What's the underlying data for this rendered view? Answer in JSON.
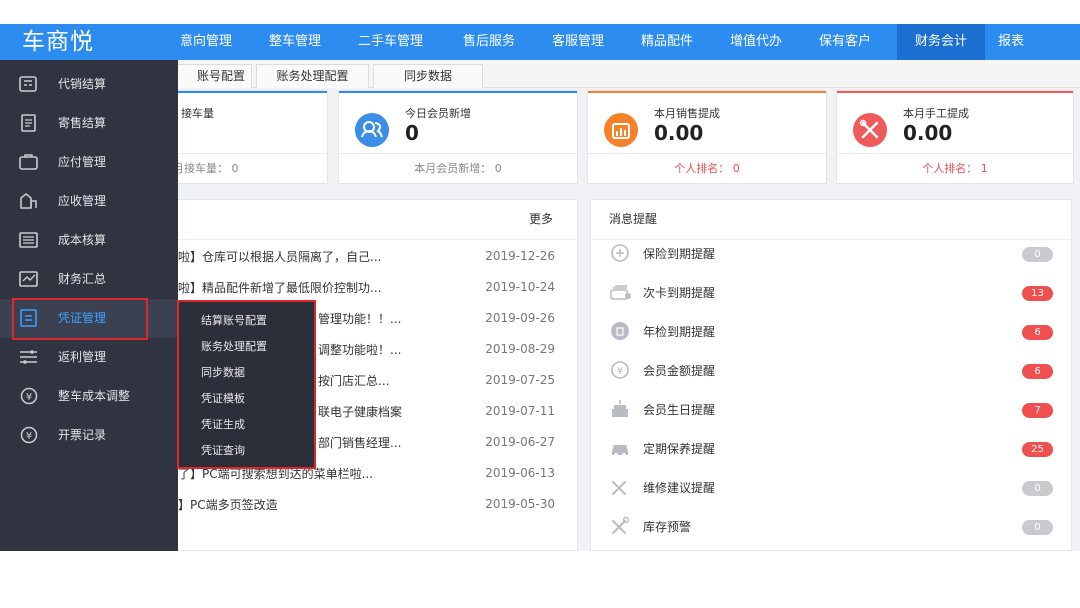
{
  "header": {
    "logo": "车商悦",
    "nav": [
      "意向管理",
      "整车管理",
      "二手车管理",
      "售后服务",
      "客服管理",
      "精品配件",
      "增值代办",
      "保有客户",
      "财务会计",
      "报表"
    ],
    "active_nav": "财务会计"
  },
  "tabs": [
    "账号配置",
    "账务处理配置",
    "同步数据"
  ],
  "sidebar": {
    "items": [
      {
        "label": "代销结算",
        "icon": "calculator-icon"
      },
      {
        "label": "寄售结算",
        "icon": "document-icon"
      },
      {
        "label": "应付管理",
        "icon": "wallet-icon"
      },
      {
        "label": "应收管理",
        "icon": "chart-icon"
      },
      {
        "label": "成本核算",
        "icon": "ledger-icon"
      },
      {
        "label": "财务汇总",
        "icon": "summary-icon"
      },
      {
        "label": "凭证管理",
        "icon": "voucher-icon"
      },
      {
        "label": "返利管理",
        "icon": "list-icon"
      },
      {
        "label": "整车成本调整",
        "icon": "yen-circle-icon"
      },
      {
        "label": "开票记录",
        "icon": "yen-circle-icon"
      }
    ],
    "active_item": "凭证管理"
  },
  "submenu": {
    "items": [
      "结算账号配置",
      "账务处理配置",
      "同步数据",
      "凭证模板",
      "凭证生成",
      "凭证查询"
    ]
  },
  "cards": [
    {
      "label": "接车量",
      "value": "",
      "footer": "月接车量： 0",
      "icon": "car-icon",
      "color": "#2d8cf0"
    },
    {
      "label": "今日会员新增",
      "value": "0",
      "footer": "本月会员新增： 0",
      "icon": "member-icon",
      "color": "#3a8ee6"
    },
    {
      "label": "本月销售提成",
      "value": "0.00",
      "footer": "个人排名： 0",
      "icon": "sales-chart-icon",
      "color": "#f5822a"
    },
    {
      "label": "本月手工提成",
      "value": "0.00",
      "footer": "个人排名： 1",
      "icon": "tools-icon",
      "color": "#ef5b5b"
    }
  ],
  "news": {
    "more": "更多",
    "items": [
      {
        "title": "啦】仓库可以根据人员隔离了，自己...",
        "date": "2019-12-26"
      },
      {
        "title": "啦】精品配件新增了最低限价控制功...",
        "date": "2019-10-24"
      },
      {
        "title": "管理功能！！...",
        "date": "2019-09-26"
      },
      {
        "title": "调整功能啦！...",
        "date": "2019-08-29"
      },
      {
        "title": "按门店汇总...",
        "date": "2019-07-25"
      },
      {
        "title": "联电子健康档案",
        "date": "2019-07-11"
      },
      {
        "title": "部门销售经理...",
        "date": "2019-06-27"
      },
      {
        "title": "了】PC端可搜索想到达的菜单栏啦...",
        "date": "2019-06-13"
      },
      {
        "title": "】PC端多页签改造",
        "date": "2019-05-30"
      }
    ]
  },
  "messages": {
    "title": "消息提醒",
    "items": [
      {
        "label": "保险到期提醒",
        "count": "0",
        "color": "#c8cacd",
        "icon": "shield-plus-icon"
      },
      {
        "label": "次卡到期提醒",
        "count": "13",
        "color": "#ef4f4f",
        "icon": "card-stack-icon"
      },
      {
        "label": "年检到期提醒",
        "count": "6",
        "color": "#ef4f4f",
        "icon": "inspection-icon"
      },
      {
        "label": "会员金额提醒",
        "count": "6",
        "color": "#ef4f4f",
        "icon": "yen-circle-icon"
      },
      {
        "label": "会员生日提醒",
        "count": "7",
        "color": "#ef4f4f",
        "icon": "cake-icon"
      },
      {
        "label": "定期保养提醒",
        "count": "25",
        "color": "#ef4f4f",
        "icon": "car-service-icon"
      },
      {
        "label": "维修建议提醒",
        "count": "0",
        "color": "#c8cacd",
        "icon": "wrench-icon"
      },
      {
        "label": "库存预警",
        "count": "0",
        "color": "#c8cacd",
        "icon": "tools-icon"
      }
    ]
  }
}
